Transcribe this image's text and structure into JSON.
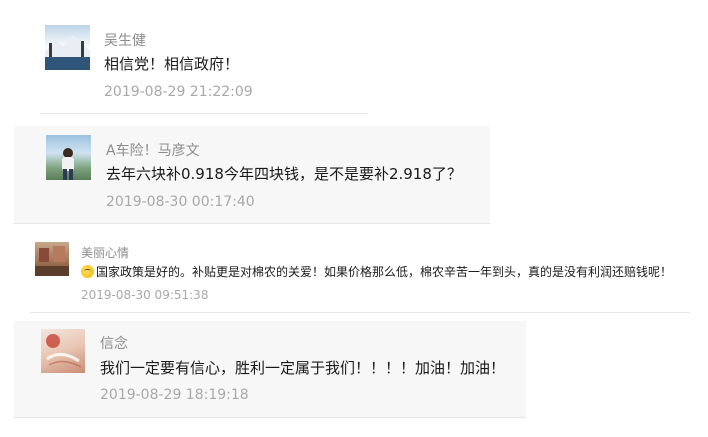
{
  "comments": [
    {
      "name": "吴生健",
      "text": "相信党！相信政府！",
      "time": "2019-08-29 21:22:09"
    },
    {
      "name": "A车险！马彦文",
      "text": "去年六块补0.918今年四块钱，是不是要补2.918了？",
      "time": "2019-08-30 00:17:40"
    },
    {
      "name": "美丽心情",
      "text": "国家政策是好的。补贴更是对棉农的关爱！如果价格那么低，棉农辛苦一年到头，真的是没有利润还赔钱呢！",
      "time": "2019-08-30 09:51:38"
    },
    {
      "name": "信念",
      "text": "我们一定要有信心，胜利一定属于我们！！！！加油！加油！",
      "time": "2019-08-29 18:19:18"
    }
  ],
  "colors": {
    "name": "#8c8c8c",
    "text": "#1a1a1a",
    "time": "#a8a8a8",
    "card_alt_bg": "#f7f7f7"
  }
}
